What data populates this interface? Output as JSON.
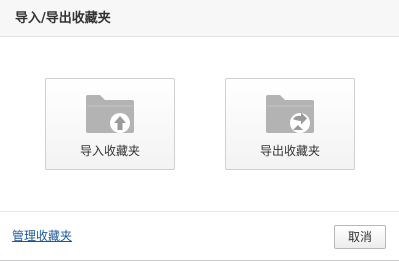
{
  "dialog": {
    "title": "导入/导出收藏夹"
  },
  "options": [
    {
      "label": "导入收藏夹",
      "icon": "folder-import-icon"
    },
    {
      "label": "导出收藏夹",
      "icon": "folder-export-icon"
    }
  ],
  "footer": {
    "manage_link": "管理收藏夹",
    "cancel_label": "取消"
  },
  "colors": {
    "folder": "#b3b3b3",
    "arrow": "#ffffff",
    "link": "#1a5a99"
  }
}
